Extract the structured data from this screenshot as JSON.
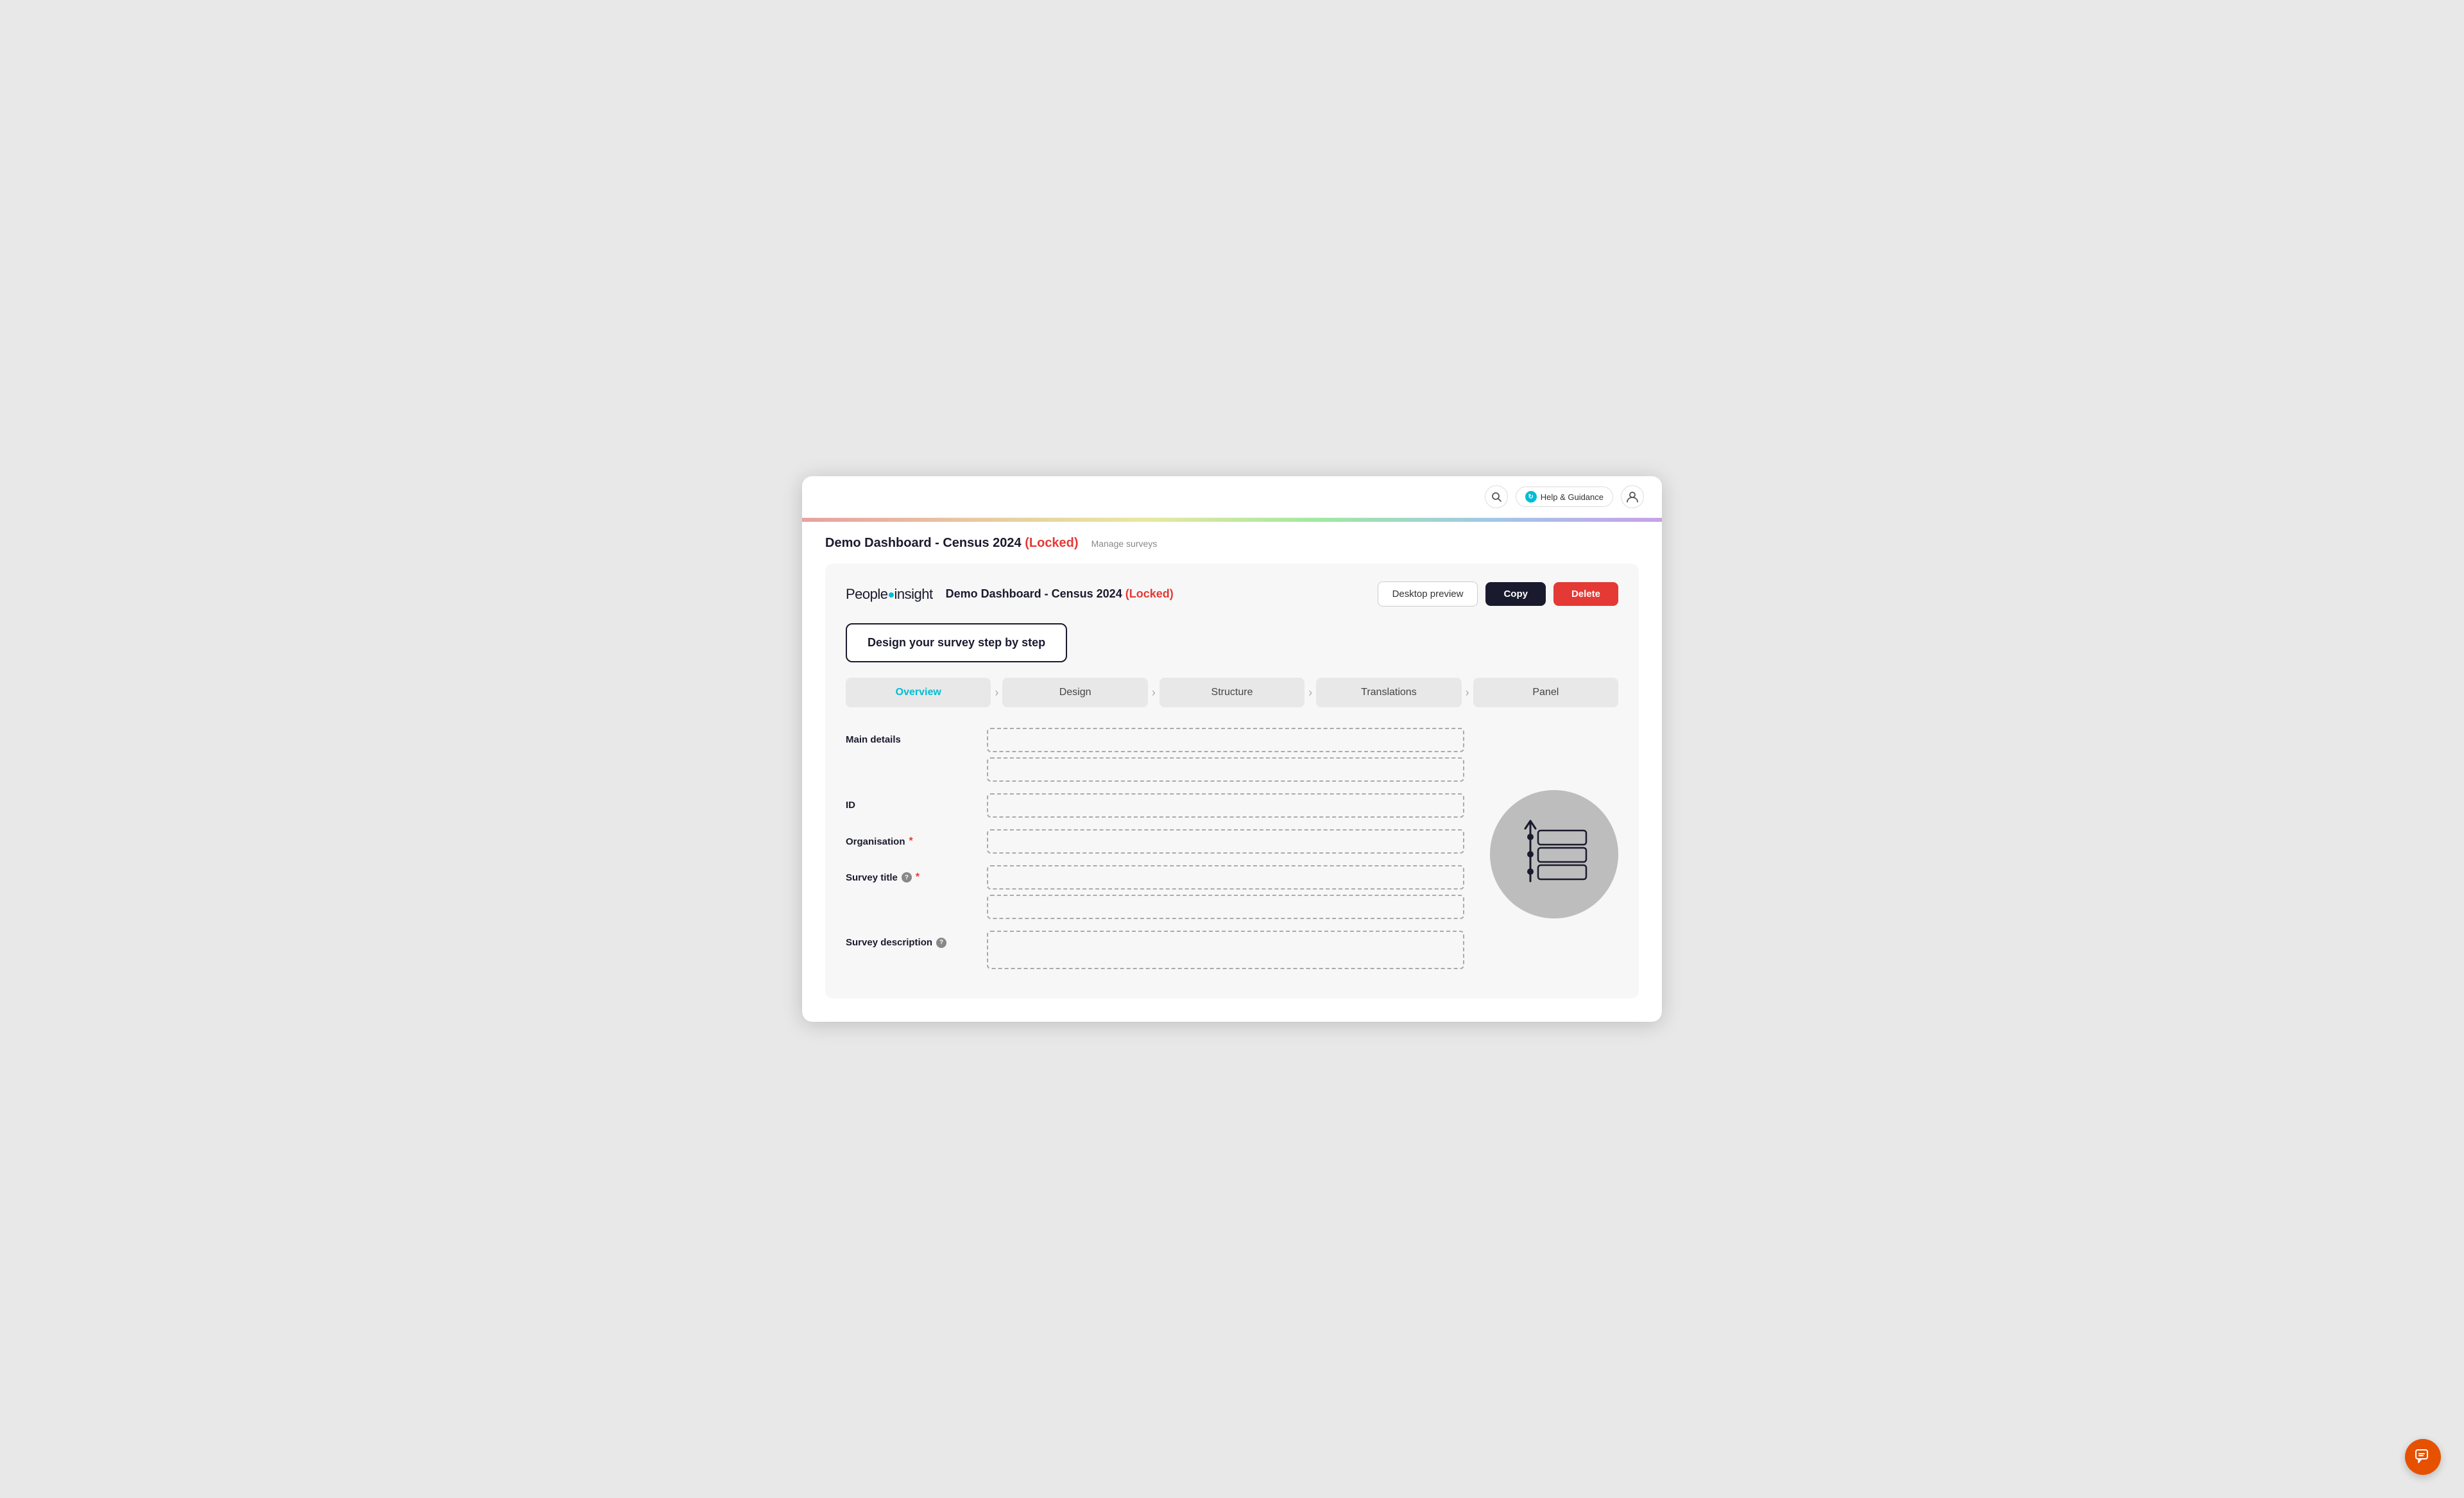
{
  "topbar": {
    "help_label": "Help & Guidance",
    "search_icon": "🔍",
    "user_icon": "👤",
    "refresh_icon": "↻"
  },
  "page": {
    "title": "Demo Dashboard - Census 2024",
    "locked_label": "(Locked)",
    "manage_link": "Manage surveys"
  },
  "card": {
    "brand": "Peopleinsight",
    "survey_title": "Demo Dashboard - Census 2024",
    "locked_label": "(Locked)",
    "btn_preview": "Desktop preview",
    "btn_copy": "Copy",
    "btn_delete": "Delete"
  },
  "design_step": {
    "label": "Design your survey step by step"
  },
  "steps": [
    {
      "label": "Overview",
      "active": true
    },
    {
      "label": "Design",
      "active": false
    },
    {
      "label": "Structure",
      "active": false
    },
    {
      "label": "Translations",
      "active": false
    },
    {
      "label": "Panel",
      "active": false
    }
  ],
  "form": {
    "section_label": "Main details",
    "fields": [
      {
        "label": "ID",
        "required": false,
        "info": false,
        "rows": 1
      },
      {
        "label": "Organisation",
        "required": true,
        "info": false,
        "rows": 1
      },
      {
        "label": "Survey title",
        "required": true,
        "info": true,
        "rows": 1
      },
      {
        "label": "Survey description",
        "required": false,
        "info": true,
        "rows": 1
      }
    ]
  },
  "chat_icon": "💬"
}
